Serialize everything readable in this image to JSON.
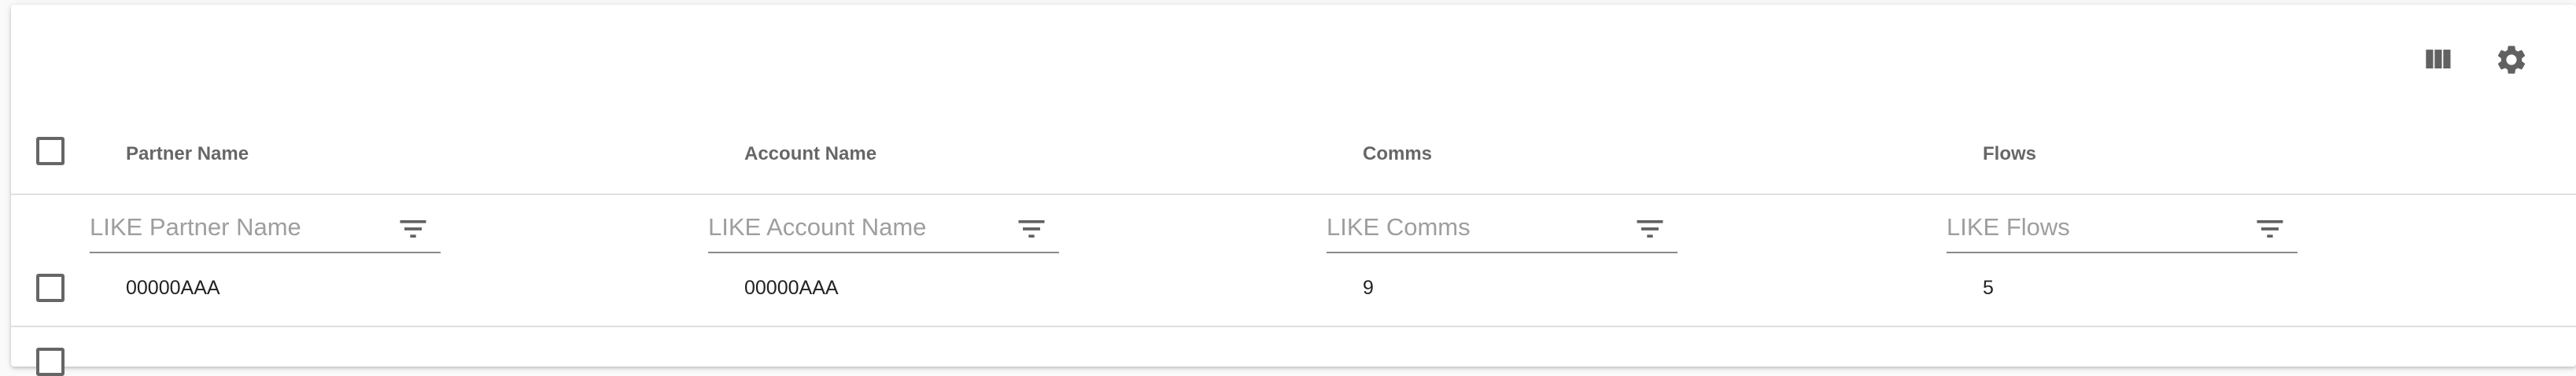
{
  "toolbar": {
    "columns_icon": "view-column-icon",
    "settings_icon": "settings-gear-icon"
  },
  "table": {
    "columns": [
      {
        "key": "partner_name",
        "label": "Partner Name",
        "filter_placeholder": "LIKE Partner Name"
      },
      {
        "key": "account_name",
        "label": "Account Name",
        "filter_placeholder": "LIKE Account Name"
      },
      {
        "key": "comms",
        "label": "Comms",
        "filter_placeholder": "LIKE Comms"
      },
      {
        "key": "flows",
        "label": "Flows",
        "filter_placeholder": "LIKE Flows"
      }
    ],
    "rows": [
      {
        "partner_name": "00000AAA",
        "account_name": "00000AAA",
        "comms": "9",
        "flows": "5"
      }
    ]
  },
  "colors": {
    "icon": "#616161",
    "divider": "#e0e0e0",
    "header_text": "#666666",
    "placeholder": "#9e9e9e"
  }
}
